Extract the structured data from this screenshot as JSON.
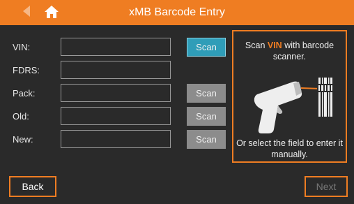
{
  "header": {
    "title": "xMB Barcode Entry",
    "back_icon": "back-arrow-icon",
    "home_icon": "home-icon",
    "color": "#ef7d22"
  },
  "fields": [
    {
      "label": "VIN:",
      "value": "",
      "scan_label": "Scan",
      "scan_visible": true,
      "scan_active": true
    },
    {
      "label": "FDRS:",
      "value": "",
      "scan_label": "",
      "scan_visible": false,
      "scan_active": false
    },
    {
      "label": "Pack:",
      "value": "",
      "scan_label": "Scan",
      "scan_visible": true,
      "scan_active": false
    },
    {
      "label": "Old:",
      "value": "",
      "scan_label": "Scan",
      "scan_visible": true,
      "scan_active": false
    },
    {
      "label": "New:",
      "value": "",
      "scan_label": "Scan",
      "scan_visible": true,
      "scan_active": false
    }
  ],
  "info_panel": {
    "text_before": "Scan ",
    "highlight": "VIN",
    "text_after": " with barcode scanner.",
    "bottom_text": "Or select the field to enter it manually.",
    "icon": "barcode-scanner-icon"
  },
  "footer": {
    "back_label": "Back",
    "next_label": "Next",
    "next_enabled": false
  },
  "colors": {
    "accent": "#ef7d22",
    "active_button": "#2f9db8",
    "inactive_button": "#8c8c8c",
    "background": "#2a2a2a"
  }
}
